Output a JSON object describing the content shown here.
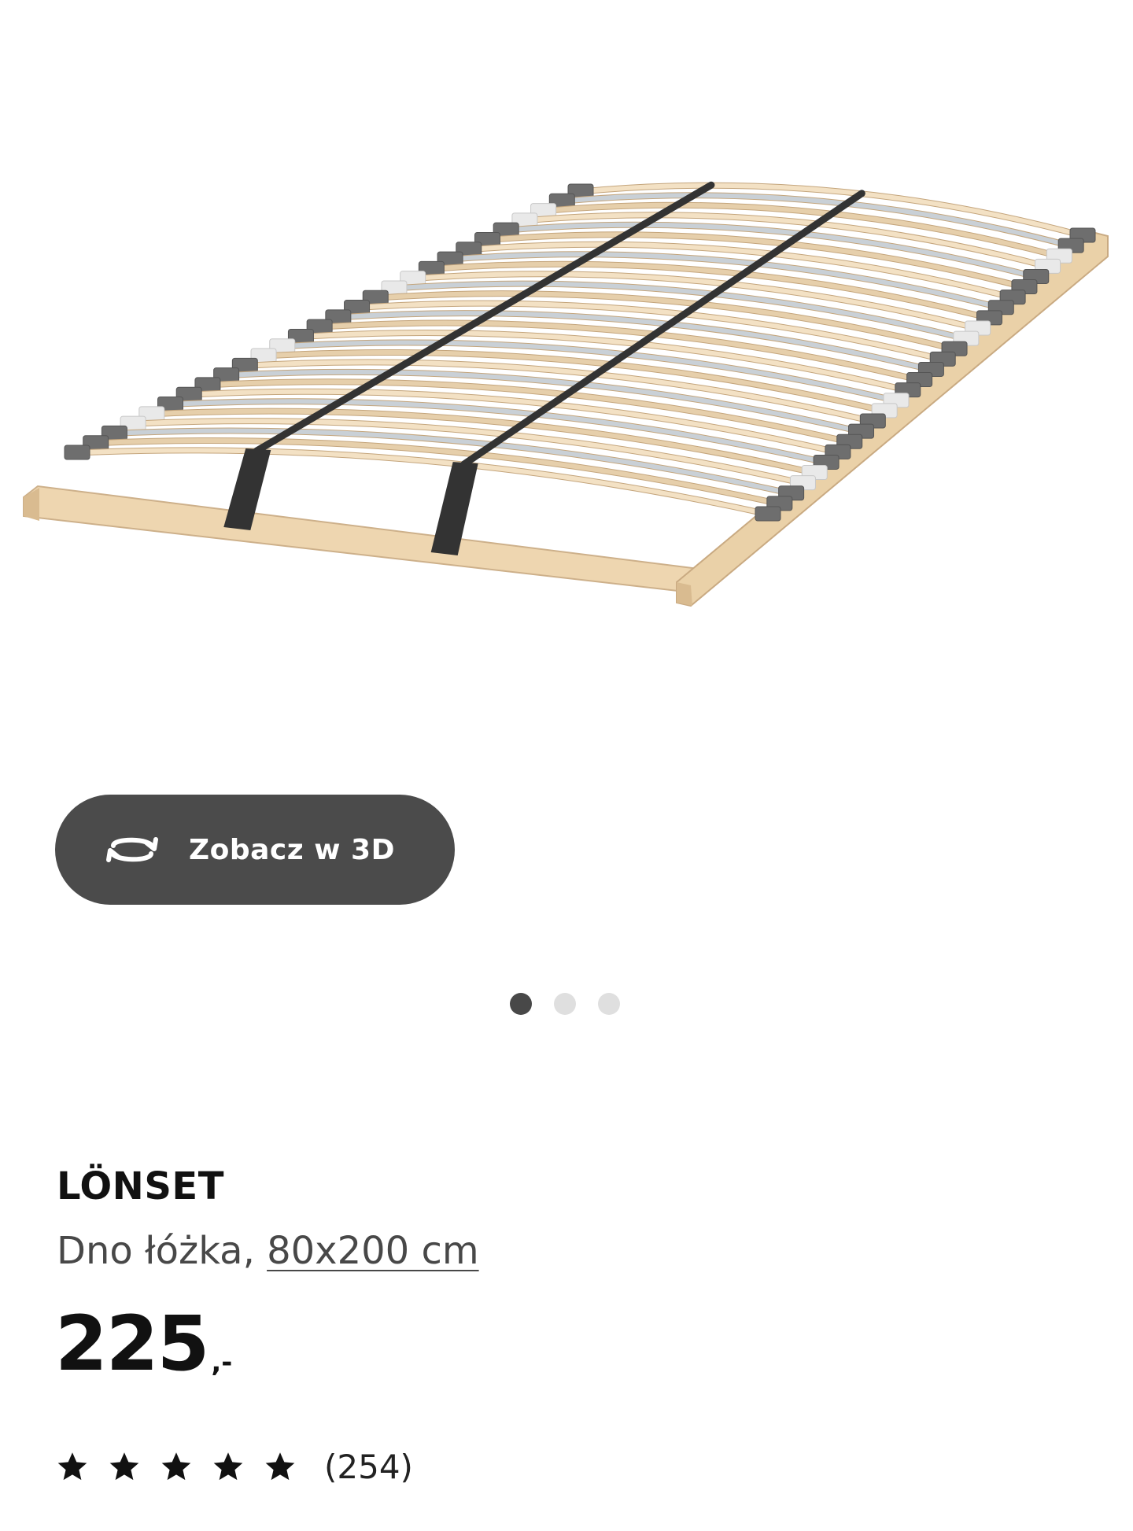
{
  "gallery": {
    "image_alt": "LÖNSET slatted bed base",
    "view_3d_label": "Zobacz w 3D",
    "dots": [
      {
        "active": true
      },
      {
        "active": false
      },
      {
        "active": false
      }
    ]
  },
  "product": {
    "name": "LÖNSET",
    "description_prefix": "Dno łóżka, ",
    "size_link": "80x200 cm",
    "price_integer": "225",
    "price_suffix": ",-",
    "rating_value": 5,
    "rating_max": 5,
    "review_count": "(254)"
  },
  "colors": {
    "button_bg": "#4b4b4b",
    "dot_active": "#484848",
    "dot_inactive": "#dfdfdf",
    "wood": "#e8cfa8",
    "strap": "#333333",
    "holder": "#6e6e6e"
  }
}
